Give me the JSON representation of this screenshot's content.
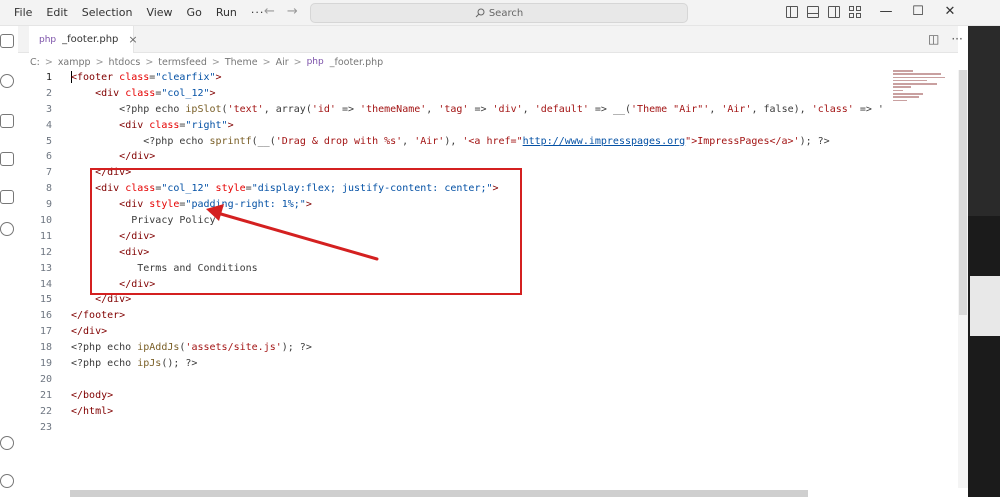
{
  "menu": {
    "items": [
      "File",
      "Edit",
      "Selection",
      "View",
      "Go",
      "Run"
    ],
    "more": "···"
  },
  "nav": {
    "back": "←",
    "forward": "→"
  },
  "search": {
    "label": "Search"
  },
  "window_controls": {
    "minimize": "—",
    "maximize": "☐",
    "close": "✕"
  },
  "tab": {
    "icon": "php",
    "label": "_footer.php",
    "close": "×"
  },
  "editor_actions": {
    "split": "◫",
    "more": "···"
  },
  "breadcrumb": {
    "items": [
      "C:",
      "xampp",
      "htdocs",
      "termsfeed",
      "Theme",
      "Air"
    ],
    "file_icon": "php",
    "file": "_footer.php",
    "separator": ">"
  },
  "line_numbers": [
    "1",
    "2",
    "3",
    "4",
    "5",
    "6",
    "7",
    "8",
    "9",
    "10",
    "11",
    "12",
    "13",
    "14",
    "15",
    "16",
    "17",
    "18",
    "19",
    "20",
    "21",
    "22",
    "23"
  ],
  "code": {
    "l1_open": "<footer ",
    "l1_attr": "class",
    "l1_eq": "=",
    "l1_val": "\"clearfix\"",
    "l1_close": ">",
    "l2_open": "<div ",
    "l2_attr": "class",
    "l2_eq": "=",
    "l2_val": "\"col_12\"",
    "l2_close": ">",
    "l3_a": "<?php echo ",
    "l3_fn": "ipSlot",
    "l3_b": "(",
    "l3_s1": "'text'",
    "l3_c": ", array(",
    "l3_s2": "'id'",
    "l3_d": " => ",
    "l3_s3": "'themeName'",
    "l3_e": ", ",
    "l3_s4": "'tag'",
    "l3_f": " => ",
    "l3_s5": "'div'",
    "l3_g": ", ",
    "l3_s6": "'default'",
    "l3_h": " => __(",
    "l3_s7": "'Theme \"Air\"'",
    "l3_i": ", ",
    "l3_s8": "'Air'",
    "l3_j": ", false), ",
    "l3_s9": "'class'",
    "l3_k": " => '",
    "l4_open": "<div ",
    "l4_attr": "class",
    "l4_eq": "=",
    "l4_val": "\"right\"",
    "l4_close": ">",
    "l5_a": "<?php echo ",
    "l5_fn": "sprintf",
    "l5_b": "(__(",
    "l5_s1": "'Drag & drop with %s'",
    "l5_c": ", ",
    "l5_s2": "'Air'",
    "l5_d": "), ",
    "l5_s3": "'<a href=\"",
    "l5_url": "http://www.impresspages.org",
    "l5_s4": "\">ImpressPages</a>'",
    "l5_e": "); ?>",
    "l6": "</div>",
    "l7": "</div>",
    "l8_open": "<div ",
    "l8_attr": "class",
    "l8_eq": "=",
    "l8_val": "\"col_12\"",
    "l8_sp": " ",
    "l8_attr2": "style",
    "l8_eq2": "=",
    "l8_val2": "\"display:flex; justify-content: center;\"",
    "l8_close": ">",
    "l9_open": "<div ",
    "l9_attr": "style",
    "l9_eq": "=",
    "l9_val": "\"padding-right: 1%;\"",
    "l9_close": ">",
    "l10": "Privacy Policy",
    "l11": "</div>",
    "l12": "<div>",
    "l13": "Terms and Conditions",
    "l14": "</div>",
    "l15": "</div>",
    "l16": "</footer>",
    "l17": "</div>",
    "l18_a": "<?php echo ",
    "l18_fn": "ipAddJs",
    "l18_b": "(",
    "l18_s": "'assets/site.js'",
    "l18_c": "); ?>",
    "l19_a": "<?php echo ",
    "l19_fn": "ipJs",
    "l19_b": "(); ?>",
    "l21": "</body>",
    "l22": "</html>"
  },
  "annotation": {
    "color": "#d42020"
  }
}
